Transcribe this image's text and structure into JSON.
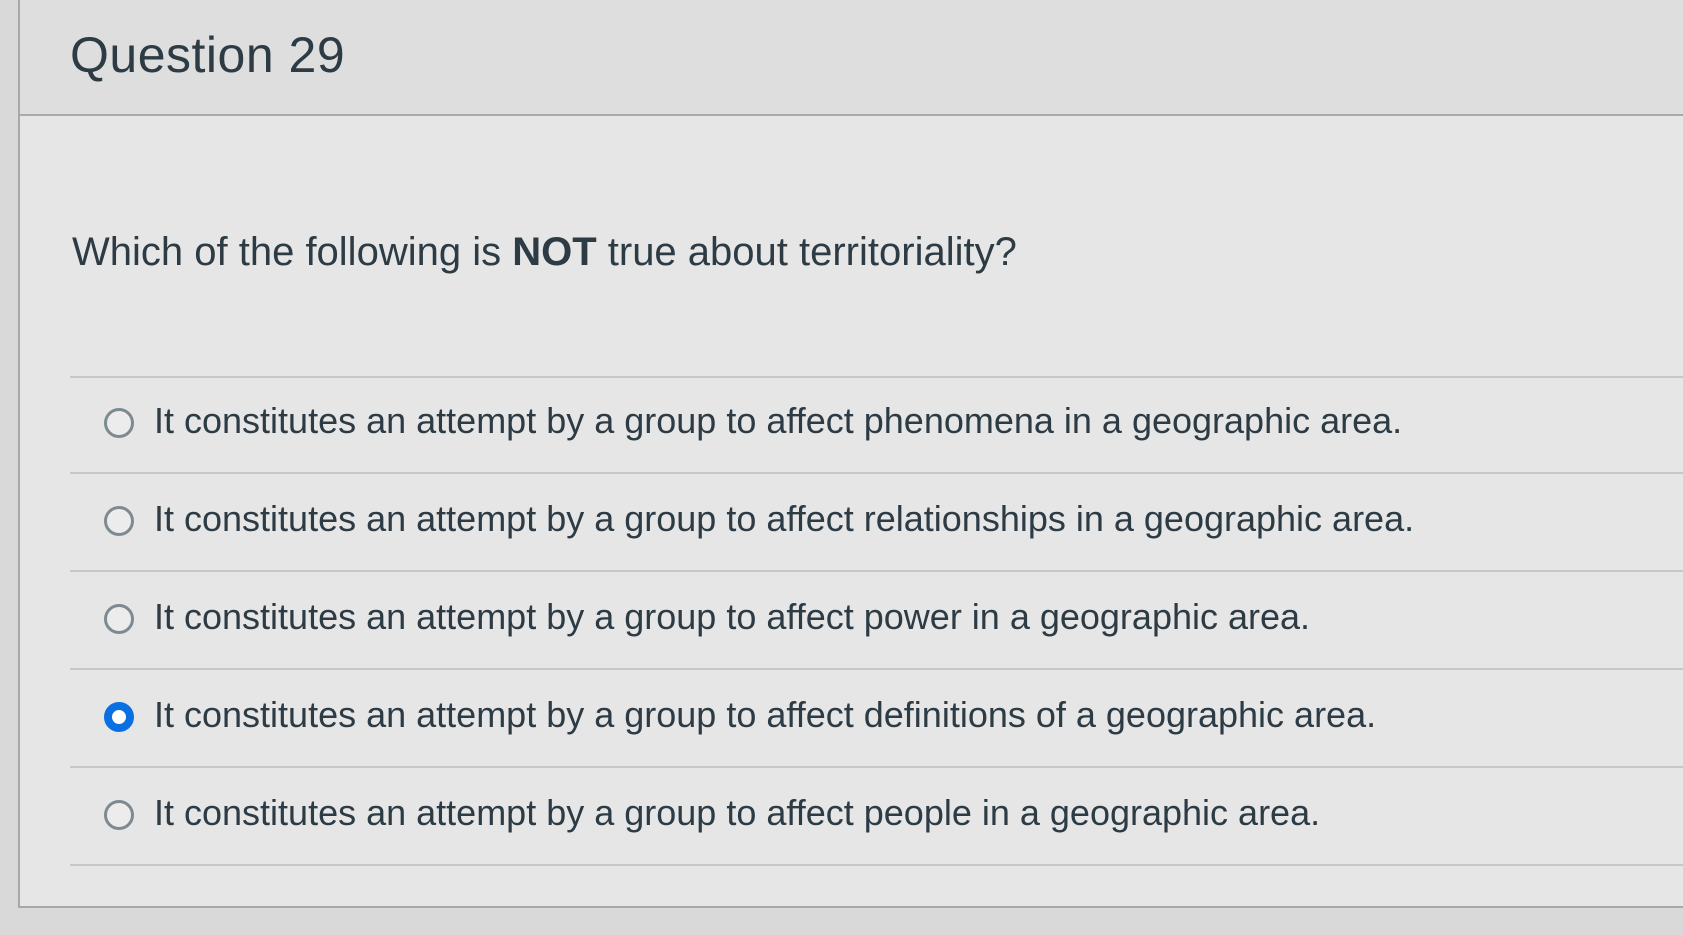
{
  "question": {
    "title": "Question 29",
    "prompt_before": "Which of the following is ",
    "prompt_emphasis": "NOT",
    "prompt_after": " true about territoriality?"
  },
  "answers": [
    {
      "label": "It constitutes an attempt by a group to affect phenomena in a geographic area.",
      "selected": false
    },
    {
      "label": "It constitutes an attempt by a group to affect relationships in a geographic area.",
      "selected": false
    },
    {
      "label": "It constitutes an attempt by a group to affect power in a geographic area.",
      "selected": false
    },
    {
      "label": "It constitutes an attempt by a group to affect definitions of a geographic area.",
      "selected": true
    },
    {
      "label": "It constitutes an attempt by a group to affect people in a geographic area.",
      "selected": false
    }
  ],
  "colors": {
    "text": "#2d3b45",
    "selected_radio": "#0a6fe0",
    "unselected_radio_border": "#7e8a92"
  }
}
